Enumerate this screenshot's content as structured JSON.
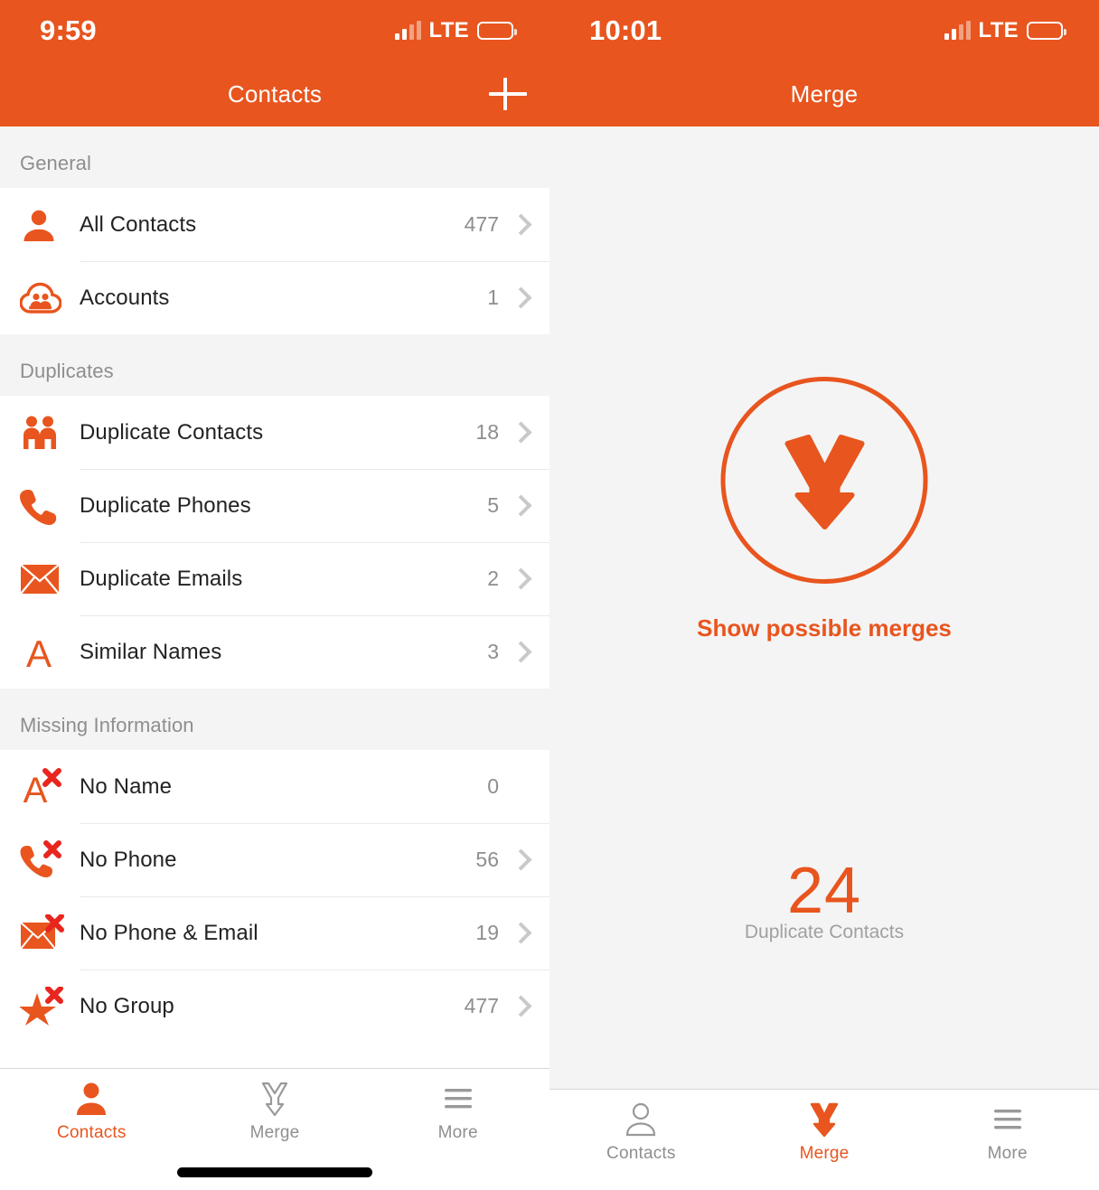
{
  "theme": {
    "accent": "#E8551E",
    "accent_red": "#E8251E",
    "muted": "#8E8E8E",
    "bg": "#F4F4F4"
  },
  "screens": {
    "contacts": {
      "status": {
        "time": "9:59",
        "network": "LTE"
      },
      "nav": {
        "title": "Contacts",
        "add_icon": "plus-icon"
      },
      "sections": [
        {
          "title": "General",
          "rows": [
            {
              "icon": "person-icon",
              "label": "All Contacts",
              "count": "477",
              "chevron": true
            },
            {
              "icon": "cloud-accounts-icon",
              "label": "Accounts",
              "count": "1",
              "chevron": true
            }
          ]
        },
        {
          "title": "Duplicates",
          "rows": [
            {
              "icon": "two-people-icon",
              "label": "Duplicate Contacts",
              "count": "18",
              "chevron": true
            },
            {
              "icon": "phone-icon",
              "label": "Duplicate Phones",
              "count": "5",
              "chevron": true
            },
            {
              "icon": "envelope-icon",
              "label": "Duplicate Emails",
              "count": "2",
              "chevron": true
            },
            {
              "icon": "letter-a-icon",
              "label": "Similar Names",
              "count": "3",
              "chevron": true
            }
          ]
        },
        {
          "title": "Missing Information",
          "rows": [
            {
              "icon": "letter-a-x-icon",
              "label": "No Name",
              "count": "0",
              "chevron": false
            },
            {
              "icon": "phone-x-icon",
              "label": "No Phone",
              "count": "56",
              "chevron": true
            },
            {
              "icon": "envelope-x-icon",
              "label": "No Phone & Email",
              "count": "19",
              "chevron": true
            },
            {
              "icon": "star-x-icon",
              "label": "No Group",
              "count": "477",
              "chevron": true
            }
          ]
        }
      ],
      "tabs": [
        {
          "icon": "person-filled-icon",
          "label": "Contacts",
          "active": true
        },
        {
          "icon": "merge-arrow-outline-icon",
          "label": "Merge",
          "active": false
        },
        {
          "icon": "hamburger-icon",
          "label": "More",
          "active": false
        }
      ]
    },
    "merge": {
      "status": {
        "time": "10:01",
        "network": "LTE"
      },
      "nav": {
        "title": "Merge"
      },
      "hero": {
        "icon": "merge-arrow-icon",
        "cta": "Show possible merges"
      },
      "stat": {
        "value": "24",
        "label": "Duplicate Contacts"
      },
      "tabs": [
        {
          "icon": "person-outline-icon",
          "label": "Contacts",
          "active": false
        },
        {
          "icon": "merge-arrow-filled-icon",
          "label": "Merge",
          "active": true
        },
        {
          "icon": "hamburger-icon",
          "label": "More",
          "active": false
        }
      ]
    }
  }
}
